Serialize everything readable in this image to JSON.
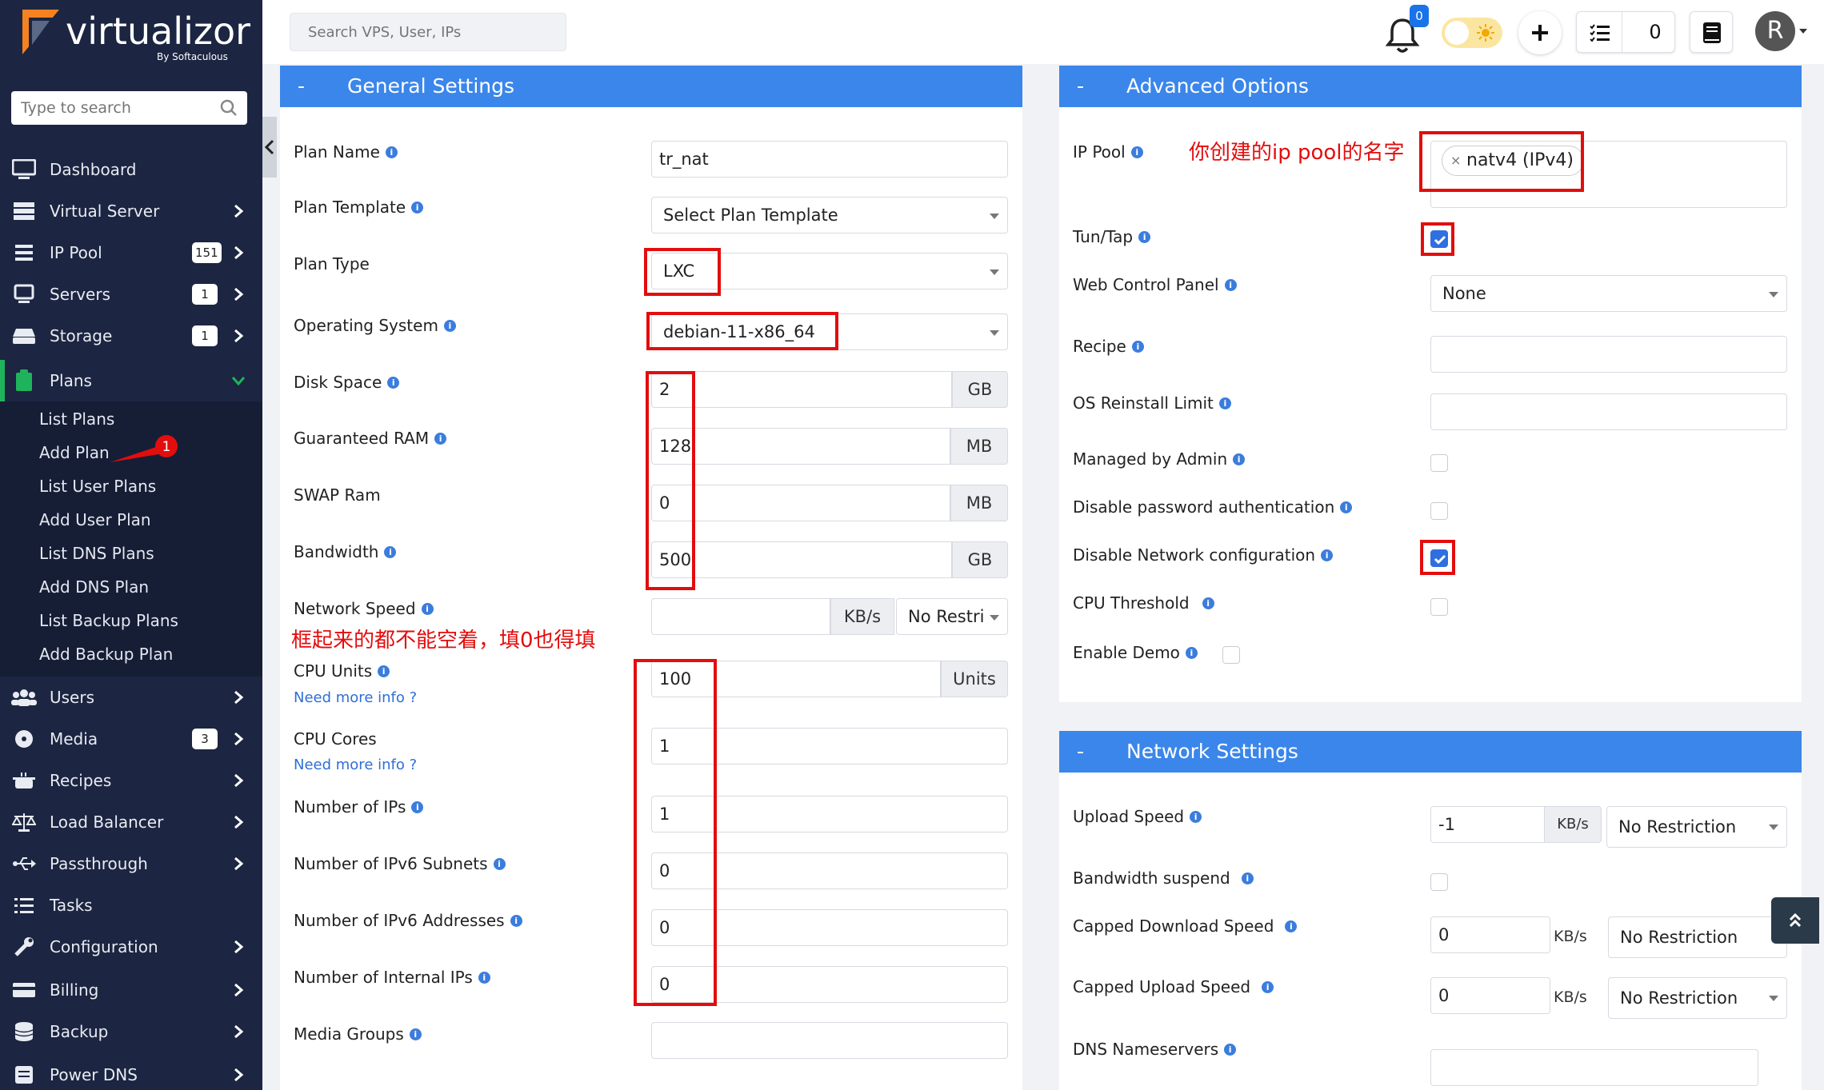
{
  "brand": {
    "name": "virtualizor",
    "by": "By Softaculous"
  },
  "sidebar": {
    "search_placeholder": "Type to search",
    "items": [
      {
        "label": "Dashboard"
      },
      {
        "label": "Virtual Server"
      },
      {
        "label": "IP Pool",
        "badge": "151"
      },
      {
        "label": "Servers",
        "badge": "1"
      },
      {
        "label": "Storage",
        "badge": "1"
      },
      {
        "label": "Plans"
      },
      {
        "label": "Users"
      },
      {
        "label": "Media",
        "badge": "3"
      },
      {
        "label": "Recipes"
      },
      {
        "label": "Load Balancer"
      },
      {
        "label": "Passthrough"
      },
      {
        "label": "Tasks"
      },
      {
        "label": "Configuration"
      },
      {
        "label": "Billing"
      },
      {
        "label": "Backup"
      },
      {
        "label": "Power DNS"
      }
    ],
    "plans_sub": [
      "List Plans",
      "Add Plan",
      "List User Plans",
      "Add User Plan",
      "List DNS Plans",
      "Add DNS Plan",
      "List Backup Plans",
      "Add Backup Plan"
    ],
    "annotation_number": "1"
  },
  "topbar": {
    "search_placeholder": "Search VPS, User, IPs",
    "notification_count": "0",
    "task_count": "0",
    "avatar_letter": "R"
  },
  "general": {
    "title": "General Settings",
    "collapse": "-",
    "plan_name": {
      "label": "Plan Name",
      "value": "tr_nat"
    },
    "plan_template": {
      "label": "Plan Template",
      "value": "Select Plan Template"
    },
    "plan_type": {
      "label": "Plan Type",
      "value": "LXC"
    },
    "os": {
      "label": "Operating System",
      "value": "debian-11-x86_64"
    },
    "disk": {
      "label": "Disk Space",
      "value": "2",
      "unit": "GB"
    },
    "ram": {
      "label": "Guaranteed RAM",
      "value": "128",
      "unit": "MB"
    },
    "swap": {
      "label": "SWAP Ram",
      "value": "0",
      "unit": "MB"
    },
    "bandwidth": {
      "label": "Bandwidth",
      "value": "500",
      "unit": "GB"
    },
    "network_speed": {
      "label": "Network Speed",
      "value": "",
      "unit": "KB/s",
      "select": "No Restri"
    },
    "cpu_units": {
      "label": "CPU Units",
      "value": "100",
      "unit": "Units",
      "help": "Need more info ?"
    },
    "cpu_cores": {
      "label": "CPU Cores",
      "value": "1",
      "help": "Need more info ?"
    },
    "num_ips": {
      "label": "Number of IPs",
      "value": "1"
    },
    "ipv6_subnets": {
      "label": "Number of IPv6 Subnets",
      "value": "0"
    },
    "ipv6_addresses": {
      "label": "Number of IPv6 Addresses",
      "value": "0"
    },
    "internal_ips": {
      "label": "Number of Internal IPs",
      "value": "0"
    },
    "media_groups": {
      "label": "Media Groups",
      "value": ""
    },
    "annotation": "框起来的都不能空着，填0也得填"
  },
  "advanced": {
    "title": "Advanced Options",
    "collapse": "-",
    "ip_pool": {
      "label": "IP Pool",
      "tag": "natv4 (IPv4)",
      "remove": "×"
    },
    "ip_pool_annotation": "你创建的ip pool的名字",
    "tun_tap": {
      "label": "Tun/Tap",
      "checked": true
    },
    "web_control_panel": {
      "label": "Web Control Panel",
      "value": "None"
    },
    "recipe": {
      "label": "Recipe",
      "value": ""
    },
    "os_reinstall_limit": {
      "label": "OS Reinstall Limit",
      "value": ""
    },
    "managed_by_admin": {
      "label": "Managed by Admin",
      "checked": false
    },
    "disable_password_auth": {
      "label": "Disable password authentication",
      "checked": false
    },
    "disable_network_config": {
      "label": "Disable Network configuration",
      "checked": true
    },
    "cpu_threshold": {
      "label": "CPU Threshold",
      "checked": false
    },
    "enable_demo": {
      "label": "Enable Demo",
      "checked": false
    }
  },
  "network": {
    "title": "Network Settings",
    "collapse": "-",
    "upload_speed": {
      "label": "Upload Speed",
      "value": "-1",
      "unit": "KB/s",
      "select": "No Restriction"
    },
    "bandwidth_suspend": {
      "label": "Bandwidth suspend",
      "checked": false
    },
    "capped_download": {
      "label": "Capped Download Speed",
      "value": "0",
      "unit": "KB/s",
      "select": "No Restriction"
    },
    "capped_upload": {
      "label": "Capped Upload Speed",
      "value": "0",
      "unit": "KB/s",
      "select": "No Restriction"
    },
    "dns_nameservers": {
      "label": "DNS Nameservers",
      "value": ""
    }
  },
  "colors": {
    "sidebar_bg": "#1c2541",
    "panel_header": "#3b86ea",
    "accent_green": "#1fb35b",
    "annotation_red": "#e30d0d",
    "checkbox_blue": "#2f6fe0"
  }
}
